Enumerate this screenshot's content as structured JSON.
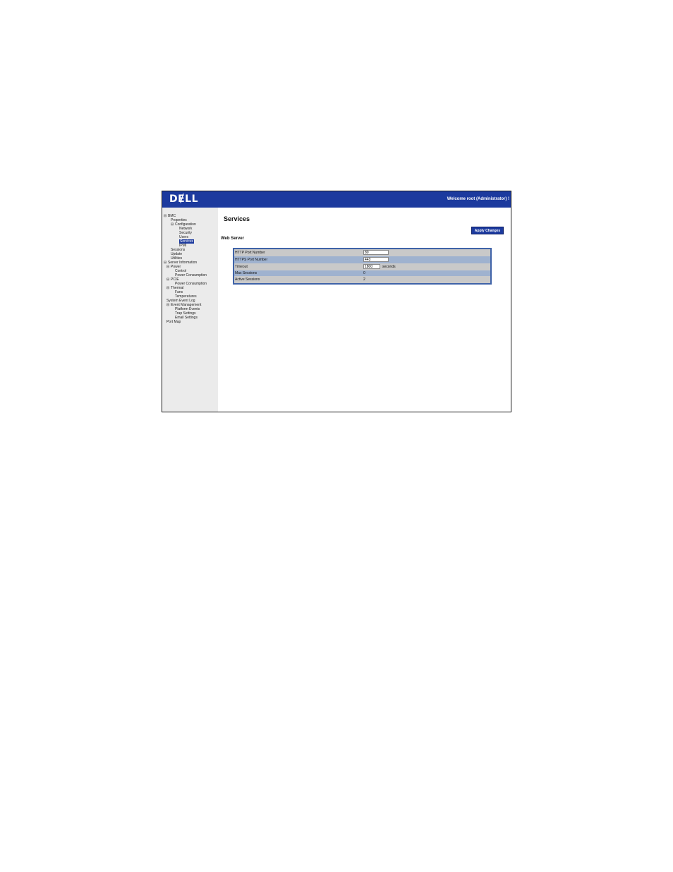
{
  "header": {
    "logo_text": "DɆLL",
    "welcome": "Welcome root (Administrator) !"
  },
  "sidebar": {
    "items": [
      {
        "label": "BMC",
        "toggle": "⊟"
      },
      {
        "label": "Properties",
        "toggle": ""
      },
      {
        "label": "Configuration",
        "toggle": "⊟"
      },
      {
        "label": "Network",
        "toggle": ""
      },
      {
        "label": "Security",
        "toggle": ""
      },
      {
        "label": "Users",
        "toggle": ""
      },
      {
        "label": "Services",
        "toggle": "",
        "selected": true
      },
      {
        "label": "IPMI",
        "toggle": ""
      },
      {
        "label": "Sessions",
        "toggle": ""
      },
      {
        "label": "Update",
        "toggle": ""
      },
      {
        "label": "Utilities",
        "toggle": ""
      },
      {
        "label": "Server Information",
        "toggle": "⊟"
      },
      {
        "label": "Power",
        "toggle": "⊟"
      },
      {
        "label": "Control",
        "toggle": ""
      },
      {
        "label": "Power Consumption",
        "toggle": ""
      },
      {
        "label": "PCIE",
        "toggle": "⊟"
      },
      {
        "label": "Power Consumption",
        "toggle": ""
      },
      {
        "label": "Thermal",
        "toggle": "⊟"
      },
      {
        "label": "Fans",
        "toggle": ""
      },
      {
        "label": "Temperatures",
        "toggle": ""
      },
      {
        "label": "System Event Log",
        "toggle": ""
      },
      {
        "label": "Event Management",
        "toggle": "⊟"
      },
      {
        "label": "Platform Events",
        "toggle": ""
      },
      {
        "label": "Trap Settings",
        "toggle": ""
      },
      {
        "label": "Email Settings",
        "toggle": ""
      },
      {
        "label": "Port Map",
        "toggle": ""
      }
    ]
  },
  "main": {
    "title": "Services",
    "apply_label": "Apply Changes",
    "section_title": "Web Server",
    "rows": [
      {
        "label": "HTTP Port Number",
        "value": "80",
        "type": "input",
        "bg": "#c9c9c9"
      },
      {
        "label": "HTTPS Port Number",
        "value": "443",
        "type": "input",
        "bg": "#9fb2cf"
      },
      {
        "label": "Timeout",
        "value": "1800",
        "type": "input",
        "unit": "seconds",
        "bg": "#c9c9c9"
      },
      {
        "label": "Max Sessions",
        "value": "0",
        "type": "text",
        "bg": "#9fb2cf"
      },
      {
        "label": "Active Sessions",
        "value": "2",
        "type": "text",
        "bg": "#c9c9c9"
      }
    ]
  },
  "colors": {
    "header_bg": "#1c3a9e",
    "sidebar_bg": "#ebebeb",
    "table_border": "#3f63a8"
  }
}
